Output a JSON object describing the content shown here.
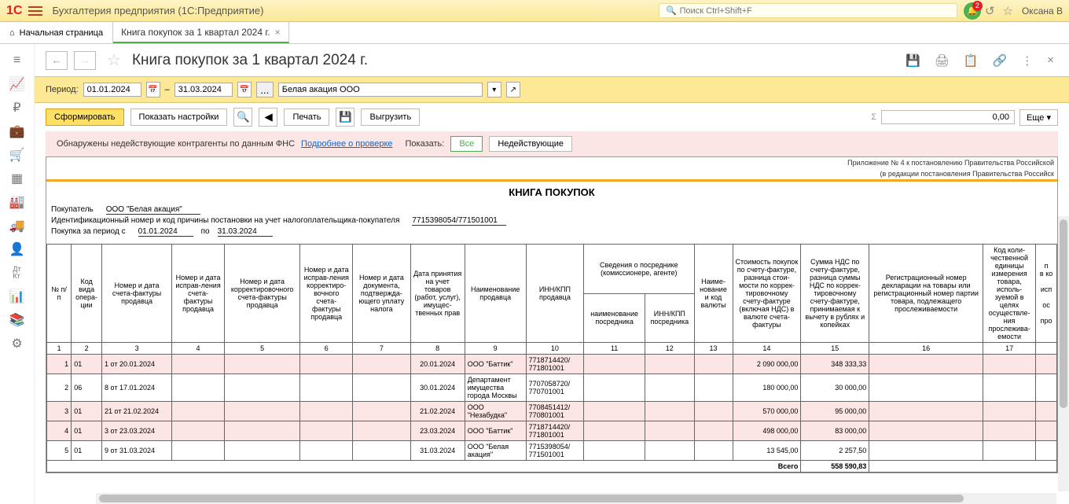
{
  "header": {
    "app_title": "Бухгалтерия предприятия  (1С:Предприятие)",
    "search_placeholder": "Поиск Ctrl+Shift+F",
    "notification_count": "2",
    "user_name": "Оксана В"
  },
  "tabs": {
    "home": "Начальная страница",
    "active": "Книга покупок за 1 квартал 2024 г."
  },
  "page": {
    "title": "Книга покупок за 1 квартал 2024 г."
  },
  "period": {
    "label": "Период:",
    "from": "01.01.2024",
    "dash": "–",
    "to": "31.03.2024",
    "org": "Белая акация ООО"
  },
  "toolbar": {
    "form": "Сформировать",
    "show_settings": "Показать настройки",
    "print": "Печать",
    "export": "Выгрузить",
    "sum_value": "0,00",
    "more": "Еще"
  },
  "warning": {
    "text": "Обнаружены недействующие контрагенты по данным ФНС",
    "link": "Подробнее о проверке",
    "show_label": "Показать:",
    "all": "Все",
    "invalid": "Недействующие"
  },
  "report": {
    "annex": "Приложение № 4 к постановлению Правительства Российской",
    "annex2": "(в редакции постановления Правительства Российск",
    "title": "КНИГА ПОКУПОК",
    "buyer_label": "Покупатель",
    "buyer_value": "ООО \"Белая акация\"",
    "inn_label": "Идентификационный номер и код причины постановки на учет налогоплательщика-покупателя",
    "inn_value": "7715398054/771501001",
    "period_label": "Покупка за период с",
    "period_from": "01.01.2024",
    "period_po": "по",
    "period_to": "31.03.2024"
  },
  "columns": {
    "c1": "№ п/п",
    "c2": "Код вида опера-ции",
    "c3": "Номер и дата счета-фактуры продавца",
    "c4": "Номер и дата исправ-ления счета-фактуры продавца",
    "c5": "Номер и дата корректировочного счета-фактуры продавца",
    "c6": "Номер и дата исправ-ления корректиро-вочного счета-фактуры продавца",
    "c7": "Номер и дата документа, подтвержда-ющего уплату налога",
    "c8": "Дата принятия на учет товаров (работ, услуг), имущес-твенных прав",
    "c9": "Наименование продавца",
    "c10": "ИНН/КПП продавца",
    "c11g": "Сведения о посреднике (комиссионере, агенте)",
    "c11": "наименование посредника",
    "c12": "ИНН/КПП посредника",
    "c13": "Наиме-нование и код валюты",
    "c14": "Стоимость покупок по счету-фактуре, разница стои-мости по коррек-тировочному счету-фактуре (включая НДС) в валюте счета-фактуры",
    "c15": "Сумма НДС по счету-фактуре, разница суммы НДС по коррек-тировочному счету-фактуре, принимаемая к вычету в рублях и копейках",
    "c16": "Регистрационный номер декларации на товары или регистрационный номер партии товара, подлежащего прослеживаемости",
    "c17": "Код коли-чественной единицы измерения товара, исполь-зуемой в целях осуществле-ния прослежива-емости",
    "c18": "п",
    "c18b": "в ко",
    "c18c": "исп",
    "c18d": "ос",
    "c18e": "про"
  },
  "rows": [
    {
      "n": "1",
      "code": "01",
      "sf": "1 от 20.01.2024",
      "date": "20.01.2024",
      "seller": "ООО \"Баттик\"",
      "inn": "7718714420/ 771801001",
      "cost": "2 090 000,00",
      "vat": "348 333,33",
      "pink": true
    },
    {
      "n": "2",
      "code": "06",
      "sf": "8 от 17.01.2024",
      "date": "30.01.2024",
      "seller": "Департамент имущества города Москвы",
      "inn": "7707058720/ 770701001",
      "cost": "180 000,00",
      "vat": "30 000,00",
      "pink": false
    },
    {
      "n": "3",
      "code": "01",
      "sf": "21 от 21.02.2024",
      "date": "21.02.2024",
      "seller": "ООО \"Незабудка\"",
      "inn": "7708451412/ 770801001",
      "cost": "570 000,00",
      "vat": "95 000,00",
      "pink": true
    },
    {
      "n": "4",
      "code": "01",
      "sf": "3 от 23.03.2024",
      "date": "23.03.2024",
      "seller": "ООО \"Баттик\"",
      "inn": "7718714420/ 771801001",
      "cost": "498 000,00",
      "vat": "83 000,00",
      "pink": true
    },
    {
      "n": "5",
      "code": "01",
      "sf": "9 от 31.03.2024",
      "date": "31.03.2024",
      "seller": "ООО \"Белая акация\"",
      "inn": "7715398054/ 771501001",
      "cost": "13 545,00",
      "vat": "2 257,50",
      "pink": false
    }
  ],
  "total": {
    "label": "Всего",
    "vat": "558 590,83"
  }
}
